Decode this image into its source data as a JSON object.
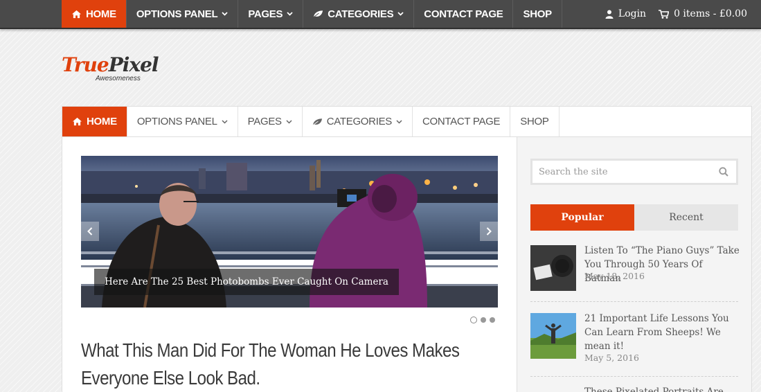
{
  "top_nav": {
    "items": [
      {
        "label": "HOME",
        "active": true
      },
      {
        "label": "OPTIONS PANEL"
      },
      {
        "label": "PAGES"
      },
      {
        "label": "CATEGORIES"
      },
      {
        "label": "CONTACT PAGE"
      },
      {
        "label": "SHOP"
      }
    ],
    "login_label": "Login",
    "cart_label": "0 items - £0.00"
  },
  "logo": {
    "part1": "True",
    "part2": "Pixel",
    "tagline": "Awesomeness"
  },
  "main_nav": {
    "items": [
      {
        "label": "HOME",
        "active": true
      },
      {
        "label": "OPTIONS PANEL"
      },
      {
        "label": "PAGES"
      },
      {
        "label": "CATEGORIES"
      },
      {
        "label": "CONTACT PAGE"
      },
      {
        "label": "SHOP"
      }
    ]
  },
  "slider": {
    "caption": "Here Are The 25 Best Photobombs Ever Caught On Camera",
    "slide_count": 3,
    "current_slide": 1
  },
  "article": {
    "headline": "What This Man Did For The Woman He Loves Makes Everyone Else Look Bad."
  },
  "sidebar": {
    "search_placeholder": "Search the site",
    "tabs": [
      {
        "label": "Popular",
        "active": true
      },
      {
        "label": "Recent"
      }
    ],
    "posts": [
      {
        "title": "Listen To “The Piano Guys” Take You Through 50 Years Of Batman",
        "date": "May 18, 2016"
      },
      {
        "title": "21 Important Life Lessons You Can Learn From Sheeps! We mean it!",
        "date": "May 5, 2016"
      },
      {
        "title": "These Pixelated Portraits Are",
        "date": ""
      }
    ]
  },
  "colors": {
    "accent": "#e0410d",
    "topbar": "#4a4a4a",
    "text": "#555555"
  }
}
